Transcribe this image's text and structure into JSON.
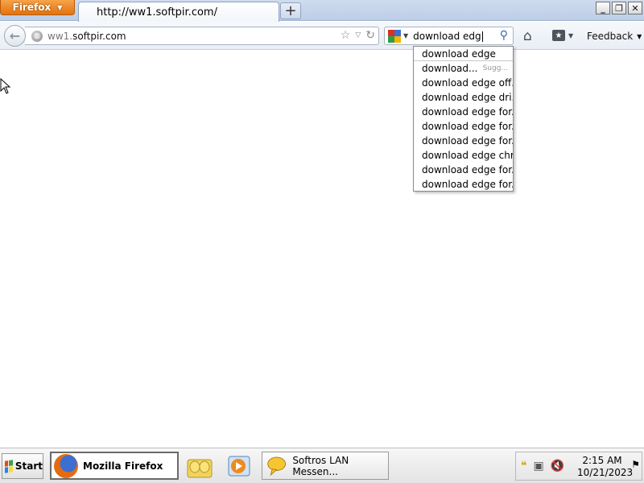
{
  "browser": {
    "menu_label": "Firefox",
    "tab_title": "http://ww1.softpir.com/",
    "new_tab_symbol": "+",
    "window_buttons": {
      "minimize": "_",
      "restore": "❐",
      "close": "✕"
    }
  },
  "navbar": {
    "url_prefix": "ww1.",
    "url_host": "softpir.com",
    "search_value": "download edg",
    "feedback_label": "Feedback"
  },
  "suggestions": {
    "items": [
      "download edge",
      "download...",
      "download edge off...",
      "download edge dri...",
      "download edge for...",
      "download edge for...",
      "download edge for...",
      "download edge chr...",
      "download edge for...",
      "download edge for..."
    ],
    "hint": "Sugg..."
  },
  "taskbar": {
    "start_label": "Start",
    "firefox_task": "Mozilla Firefox",
    "lan_task": "Softros LAN Messen...",
    "time": "2:15 AM",
    "date": "10/21/2023"
  },
  "colors": {
    "firefox_orange": "#e2720f",
    "search_icon_blue": "#3a6aa6",
    "google_red": "#d93025",
    "google_blue": "#3b6fd8",
    "google_green": "#2e9e44",
    "google_yellow": "#f4b400"
  },
  "icons": [
    "back-arrow-icon",
    "globe-icon",
    "star-icon",
    "dropdown-icon",
    "reload-icon",
    "google-icon",
    "search-icon",
    "home-icon",
    "bookmarks-icon",
    "windows-logo-icon",
    "firefox-icon",
    "folder-icon",
    "media-player-icon",
    "chat-icon",
    "volume-muted-icon"
  ]
}
